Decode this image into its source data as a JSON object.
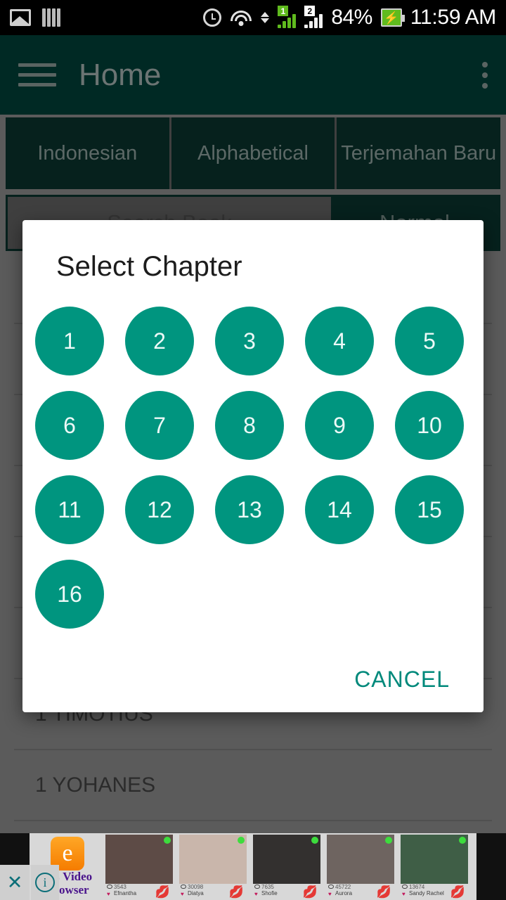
{
  "status_bar": {
    "icons": [
      "gallery-icon",
      "sim-cards-icon",
      "alarm-icon",
      "wifi-icon",
      "data-transfer-icon"
    ],
    "sim1_label": "1",
    "sim2_label": "2",
    "battery_percent": "84%",
    "battery_state": "charging",
    "time": "11:59 AM"
  },
  "app_bar": {
    "menu_icon": "hamburger-icon",
    "title": "Home",
    "overflow_icon": "more-vertical-icon"
  },
  "tabs": [
    {
      "label": "Indonesian"
    },
    {
      "label": "Alphabetical"
    },
    {
      "label": "Terjemahan Baru"
    }
  ],
  "search": {
    "placeholder": "Search Book",
    "value": "",
    "mode_button": "Normal"
  },
  "book_list": [
    {
      "name": ""
    },
    {
      "name": ""
    },
    {
      "name": ""
    },
    {
      "name": ""
    },
    {
      "name": ""
    },
    {
      "name": ""
    },
    {
      "name": "1 TIMOTIUS"
    },
    {
      "name": "1 YOHANES"
    }
  ],
  "dialog": {
    "title": "Select Chapter",
    "chapters": [
      "1",
      "2",
      "3",
      "4",
      "5",
      "6",
      "7",
      "8",
      "9",
      "10",
      "11",
      "12",
      "13",
      "14",
      "15",
      "16"
    ],
    "cancel_label": "CANCEL",
    "chip_color": "#00957f",
    "accent_color": "#00897b"
  },
  "ad": {
    "brand_line1": "UC Video",
    "brand_line2": "Browser",
    "logo_glyph": "e",
    "close_label": "✕",
    "info_label": "i",
    "cards": [
      {
        "views": "3543",
        "name": "Efnantha"
      },
      {
        "views": "30098",
        "name": "Diatya"
      },
      {
        "views": "7635",
        "name": "Shofie"
      },
      {
        "views": "45722",
        "name": "Aurora"
      },
      {
        "views": "13674",
        "name": "Sandy Rachel"
      }
    ]
  },
  "theme": {
    "app_bar_bg": "#01483f",
    "tab_bg": "#0c3a33",
    "teal": "#00957f"
  }
}
